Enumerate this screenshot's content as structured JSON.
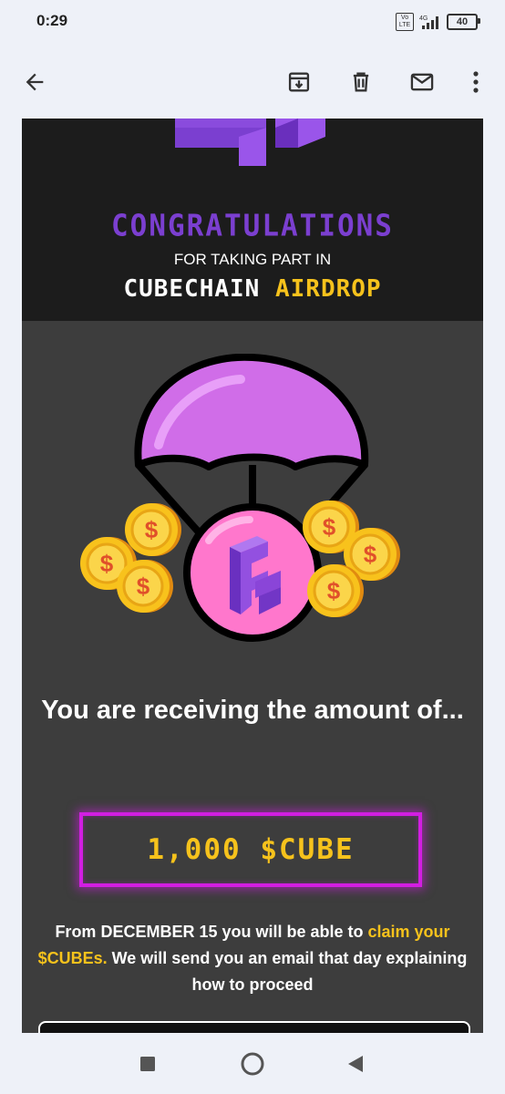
{
  "status_bar": {
    "time": "0:29",
    "network": "4G",
    "volte": "Vo LTE",
    "battery": "40"
  },
  "toolbar": {
    "back_icon": "arrow-back-icon",
    "archive_icon": "archive-icon",
    "delete_icon": "trash-icon",
    "mark_unread_icon": "mail-icon",
    "more_icon": "more-vert-icon"
  },
  "email": {
    "congrats": "CONGRATULATIONS",
    "taking_part": "FOR TAKING PART IN",
    "brand_main": "CUBECHAIN",
    "brand_accent": "AIRDROP",
    "receiving": "You are receiving the amount of...",
    "amount": "1,000 $CUBE",
    "claim_prefix": "From DECEMBER 15 you will be able to ",
    "claim_highlight": "claim your $CUBEs.",
    "claim_suffix": " We will send you an email that day explaining how to proceed",
    "colors": {
      "purple": "#7b3fd0",
      "yellow": "#f6c21c",
      "neon": "#d21ee2",
      "bg": "#3d3d3d",
      "header_bg": "#1c1c1c"
    }
  },
  "nav_bar": {
    "recents_icon": "square-icon",
    "home_icon": "circle-icon",
    "back_icon": "triangle-back-icon"
  }
}
